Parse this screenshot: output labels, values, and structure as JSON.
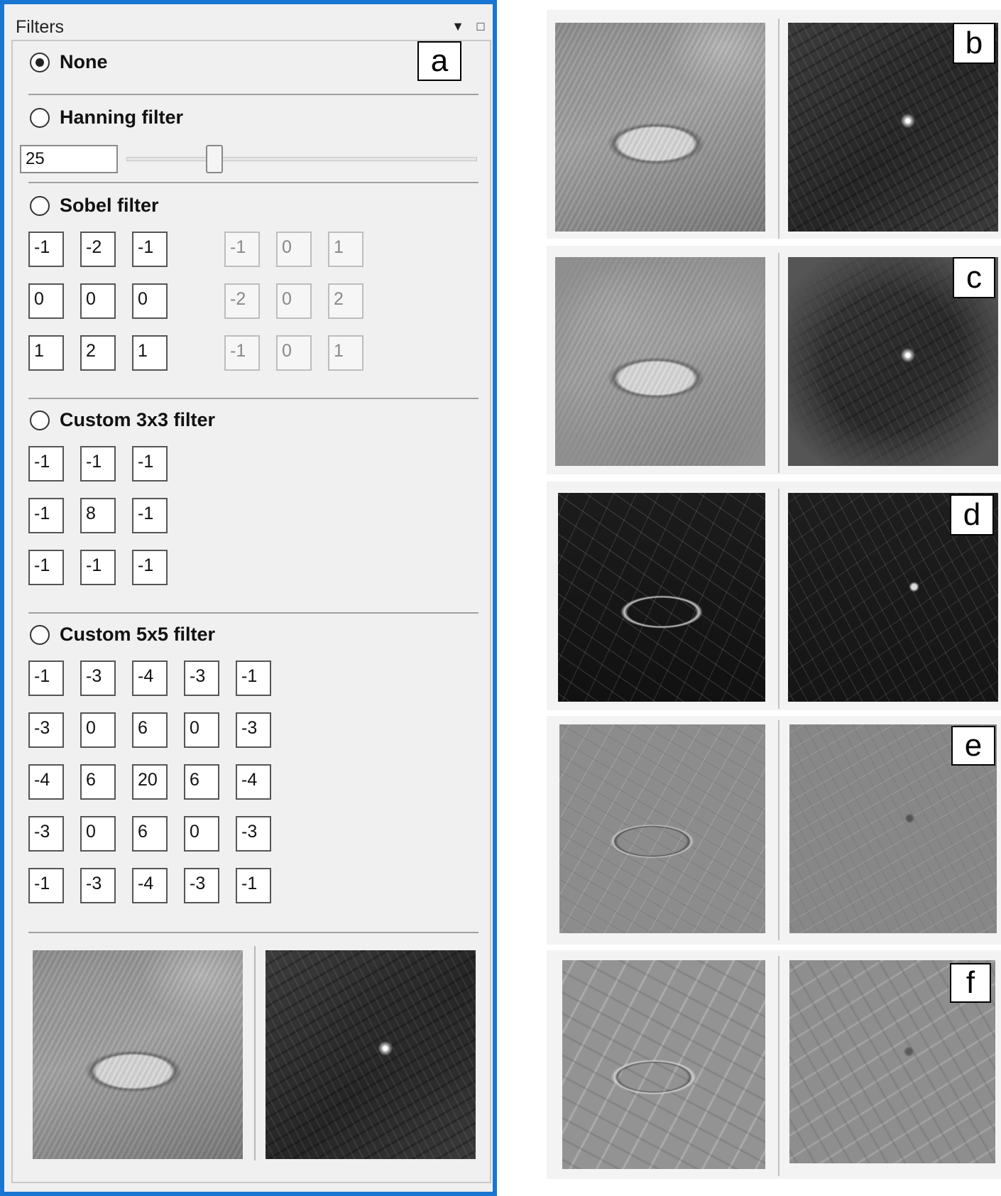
{
  "panel": {
    "title": "Filters",
    "tag": "a",
    "filters": {
      "none_label": "None",
      "hanning_label": "Hanning filter",
      "hanning_value": "25",
      "hanning_slider_fraction": 0.25,
      "sobel_label": "Sobel filter",
      "sobel_x": [
        [
          "-1",
          "-2",
          "-1"
        ],
        [
          "0",
          "0",
          "0"
        ],
        [
          "1",
          "2",
          "1"
        ]
      ],
      "sobel_y": [
        [
          "-1",
          "0",
          "1"
        ],
        [
          "-2",
          "0",
          "2"
        ],
        [
          "-1",
          "0",
          "1"
        ]
      ],
      "custom3_label": "Custom 3x3 filter",
      "custom3": [
        [
          "-1",
          "-1",
          "-1"
        ],
        [
          "-1",
          "8",
          "-1"
        ],
        [
          "-1",
          "-1",
          "-1"
        ]
      ],
      "custom5_label": "Custom 5x5 filter",
      "custom5": [
        [
          "-1",
          "-3",
          "-4",
          "-3",
          "-1"
        ],
        [
          "-3",
          "0",
          "6",
          "0",
          "-3"
        ],
        [
          "-4",
          "6",
          "20",
          "6",
          "-4"
        ],
        [
          "-3",
          "0",
          "6",
          "0",
          "-3"
        ],
        [
          "-1",
          "-3",
          "-4",
          "-3",
          "-1"
        ]
      ],
      "selected": "None"
    }
  },
  "right_tags": [
    "b",
    "c",
    "d",
    "e",
    "f"
  ]
}
